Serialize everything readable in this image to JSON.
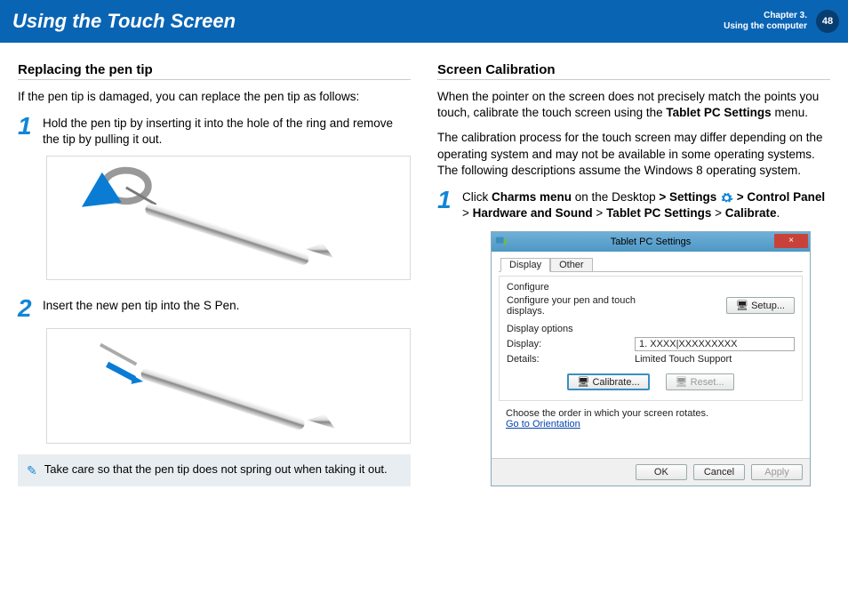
{
  "header": {
    "title": "Using the Touch Screen",
    "chapter_line1": "Chapter 3.",
    "chapter_line2": "Using the computer",
    "page_number": "48"
  },
  "left": {
    "section_title": "Replacing the pen tip",
    "intro": "If the pen tip is damaged, you can replace the pen tip as follows:",
    "step1_num": "1",
    "step1_text": "Hold the pen tip by inserting it into the hole of the ring and remove the tip by pulling it out.",
    "step2_num": "2",
    "step2_text": "Insert the new pen tip into the S Pen.",
    "note": "Take care so that the pen tip does not spring out when taking it out."
  },
  "right": {
    "section_title": "Screen Calibration",
    "para1_a": "When the pointer on the screen does not precisely match the points you touch, calibrate the touch screen using the ",
    "para1_b": "Tablet PC Settings",
    "para1_c": " menu.",
    "para2": "The calibration process for the touch screen may differ depending on the operating system and may not be available in some operating systems. The following descriptions assume the Windows 8 operating system.",
    "step1_num": "1",
    "step1_seg1": "Click ",
    "step1_seg2": "Charms menu",
    "step1_seg3": " on the Desktop ",
    "step1_seg4": "> ",
    "step1_seg5": "Settings",
    "step1_seg6": " ",
    "step1_seg7": "> ",
    "step1_seg8": "Control Panel",
    "step1_seg9": " > ",
    "step1_seg10": "Hardware and Sound",
    "step1_seg11": " > ",
    "step1_seg12": "Tablet PC Settings",
    "step1_seg13": " > ",
    "step1_seg14": "Calibrate",
    "step1_seg15": "."
  },
  "dialog": {
    "title": "Tablet PC Settings",
    "close_label": "×",
    "tab_display": "Display",
    "tab_other": "Other",
    "configure_heading": "Configure",
    "configure_text": "Configure your pen and touch displays.",
    "setup_button": "Setup...",
    "display_options_heading": "Display options",
    "display_label": "Display:",
    "display_value": "1.  XXXX|XXXXXXXXX",
    "details_label": "Details:",
    "details_value": "Limited Touch Support",
    "calibrate_button": "Calibrate...",
    "reset_button": "Reset...",
    "orient_text": "Choose the order in which your screen rotates.",
    "orient_link": "Go to Orientation",
    "ok": "OK",
    "cancel": "Cancel",
    "apply": "Apply"
  }
}
